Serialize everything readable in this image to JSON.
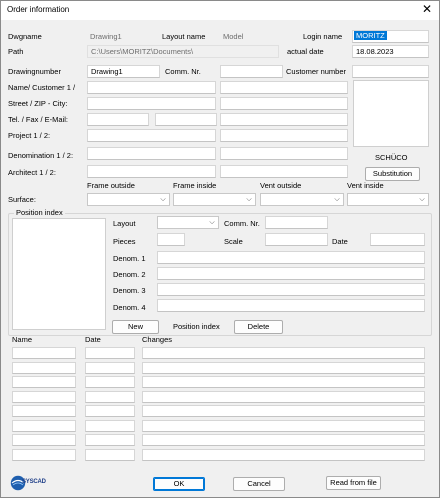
{
  "window": {
    "title": "Order information"
  },
  "header": {
    "dwgname_label": "Dwgname",
    "dwgname_value": "Drawing1",
    "layoutname_label": "Layout name",
    "layoutname_value": "Model",
    "login_label": "Login name",
    "login_value": "MORITZ",
    "path_label": "Path",
    "path_value": "C:\\Users\\MORITZ\\Documents\\",
    "actualdate_label": "actual date",
    "actualdate_value": "18.08.2023"
  },
  "form": {
    "drawingnumber_label": "Drawingnumber",
    "drawingnumber_value": "Drawing1",
    "commnr_label": "Comm. Nr.",
    "customernumber_label": "Customer number",
    "name_label": "Name/ Customer 1 /",
    "street_label": "Street / ZIP - City:",
    "tel_label": "Tel. / Fax / E-Mail:",
    "project_label": "Project 1 / 2:",
    "denomination_label": "Denomination 1 / 2:",
    "architect_label": "Architect 1 / 2:",
    "brand_label": "SCHÜCO",
    "substitution_button": "Substitution"
  },
  "surface": {
    "label": "Surface:",
    "frame_outside": "Frame outside",
    "frame_inside": "Frame inside",
    "vent_outside": "Vent outside",
    "vent_inside": "Vent inside"
  },
  "position": {
    "group_title": "Position index",
    "layout_label": "Layout",
    "commnr_label": "Comm. Nr.",
    "pieces_label": "Pieces",
    "scale_label": "Scale",
    "date_label": "Date",
    "denom1_label": "Denom. 1",
    "denom2_label": "Denom. 2",
    "denom3_label": "Denom. 3",
    "denom4_label": "Denom. 4",
    "new_button": "New",
    "index_label": "Position index",
    "delete_button": "Delete"
  },
  "changes": {
    "name_header": "Name",
    "date_header": "Date",
    "changes_header": "Changes"
  },
  "footer": {
    "logo_text": "SYSCAD",
    "ok_button": "OK",
    "cancel_button": "Cancel",
    "read_button": "Read from file"
  },
  "icons": {
    "close": "close-icon",
    "dropdown": "chevron-down-icon",
    "logo": "syscad-logo"
  },
  "colors": {
    "accent": "#0078d7",
    "window_bg": "#f0f0f0",
    "field_bg": "#ffffff"
  }
}
